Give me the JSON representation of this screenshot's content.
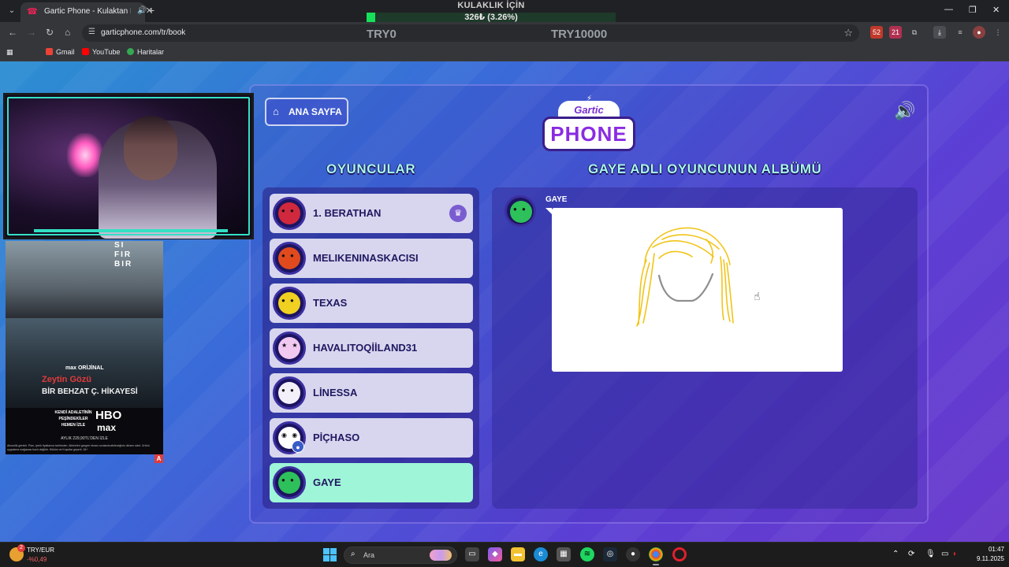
{
  "browser": {
    "tab_title": "Gartic Phone - Kulaktan Ku",
    "url": "garticphone.com/tr/book",
    "bookmarks": [
      "Gmail",
      "YouTube",
      "Haritalar"
    ],
    "extension_badges": [
      "52",
      "21"
    ]
  },
  "overlay": {
    "title": "KULAKLIK İÇİN",
    "progress_text": "326₺ (3.26%)",
    "progress_fraction": 0.0326,
    "left_label": "TRY0",
    "right_label": "TRY10000",
    "accent": "#16e05a"
  },
  "game": {
    "home_label": "ANA SAYFA",
    "logo_top": "Gartic",
    "logo_main": "PHONE",
    "players_heading": "OYUNCULAR",
    "album_heading": "GAYE ADLI OYUNCUNUN ALBÜMÜ",
    "players": [
      {
        "name": "1. BERATHAN",
        "face": "#d0283c",
        "crown": true
      },
      {
        "name": "MELIKENINASKACISI",
        "face": "#e04a1c"
      },
      {
        "name": "TEXAS",
        "face": "#f0d020"
      },
      {
        "name": "HAVALITOQİİLAND31",
        "face": "#f0c8f0"
      },
      {
        "name": "LİNESSA",
        "face": "#f4f0fa"
      },
      {
        "name": "PİÇHASO",
        "face": "#ffffff",
        "user_badge": true
      },
      {
        "name": "GAYE",
        "face": "#2ec05a",
        "active": true
      }
    ],
    "album": {
      "author": "GAYE",
      "author_face": "#2ec05a"
    }
  },
  "ad": {
    "show_title": "SI FIR BIR",
    "brand": "max ORİJİNAL",
    "red_title": "Zeytin Gözü",
    "subtitle": "BİR BEHZAT Ç. HİKAYESİ",
    "tagline": "KENDİ ADALETİNİN PEŞİNDEKİLER",
    "cta": "HEMEN İZLE",
    "hbo": "HBO",
    "max": "max",
    "price": "AYLIK 229,90TL'DEN İZLE",
    "disclaimer": "Abonelik gerekir. Plan, içerik fiyatlarına tarihinden. Albümleri gezgeri ekranı sonlandırabileceğiniz dönem adet. Ürünü uygulama mağazası bazlı değildir. Hüküm ve Koşullar geçerli. 18+",
    "corner": "A"
  },
  "taskbar": {
    "widget_title": "TRY/EUR",
    "widget_value": "-%0,49",
    "widget_badge": "2",
    "search_placeholder": "Ara",
    "time": "01:47",
    "date": "9.11.2025"
  }
}
